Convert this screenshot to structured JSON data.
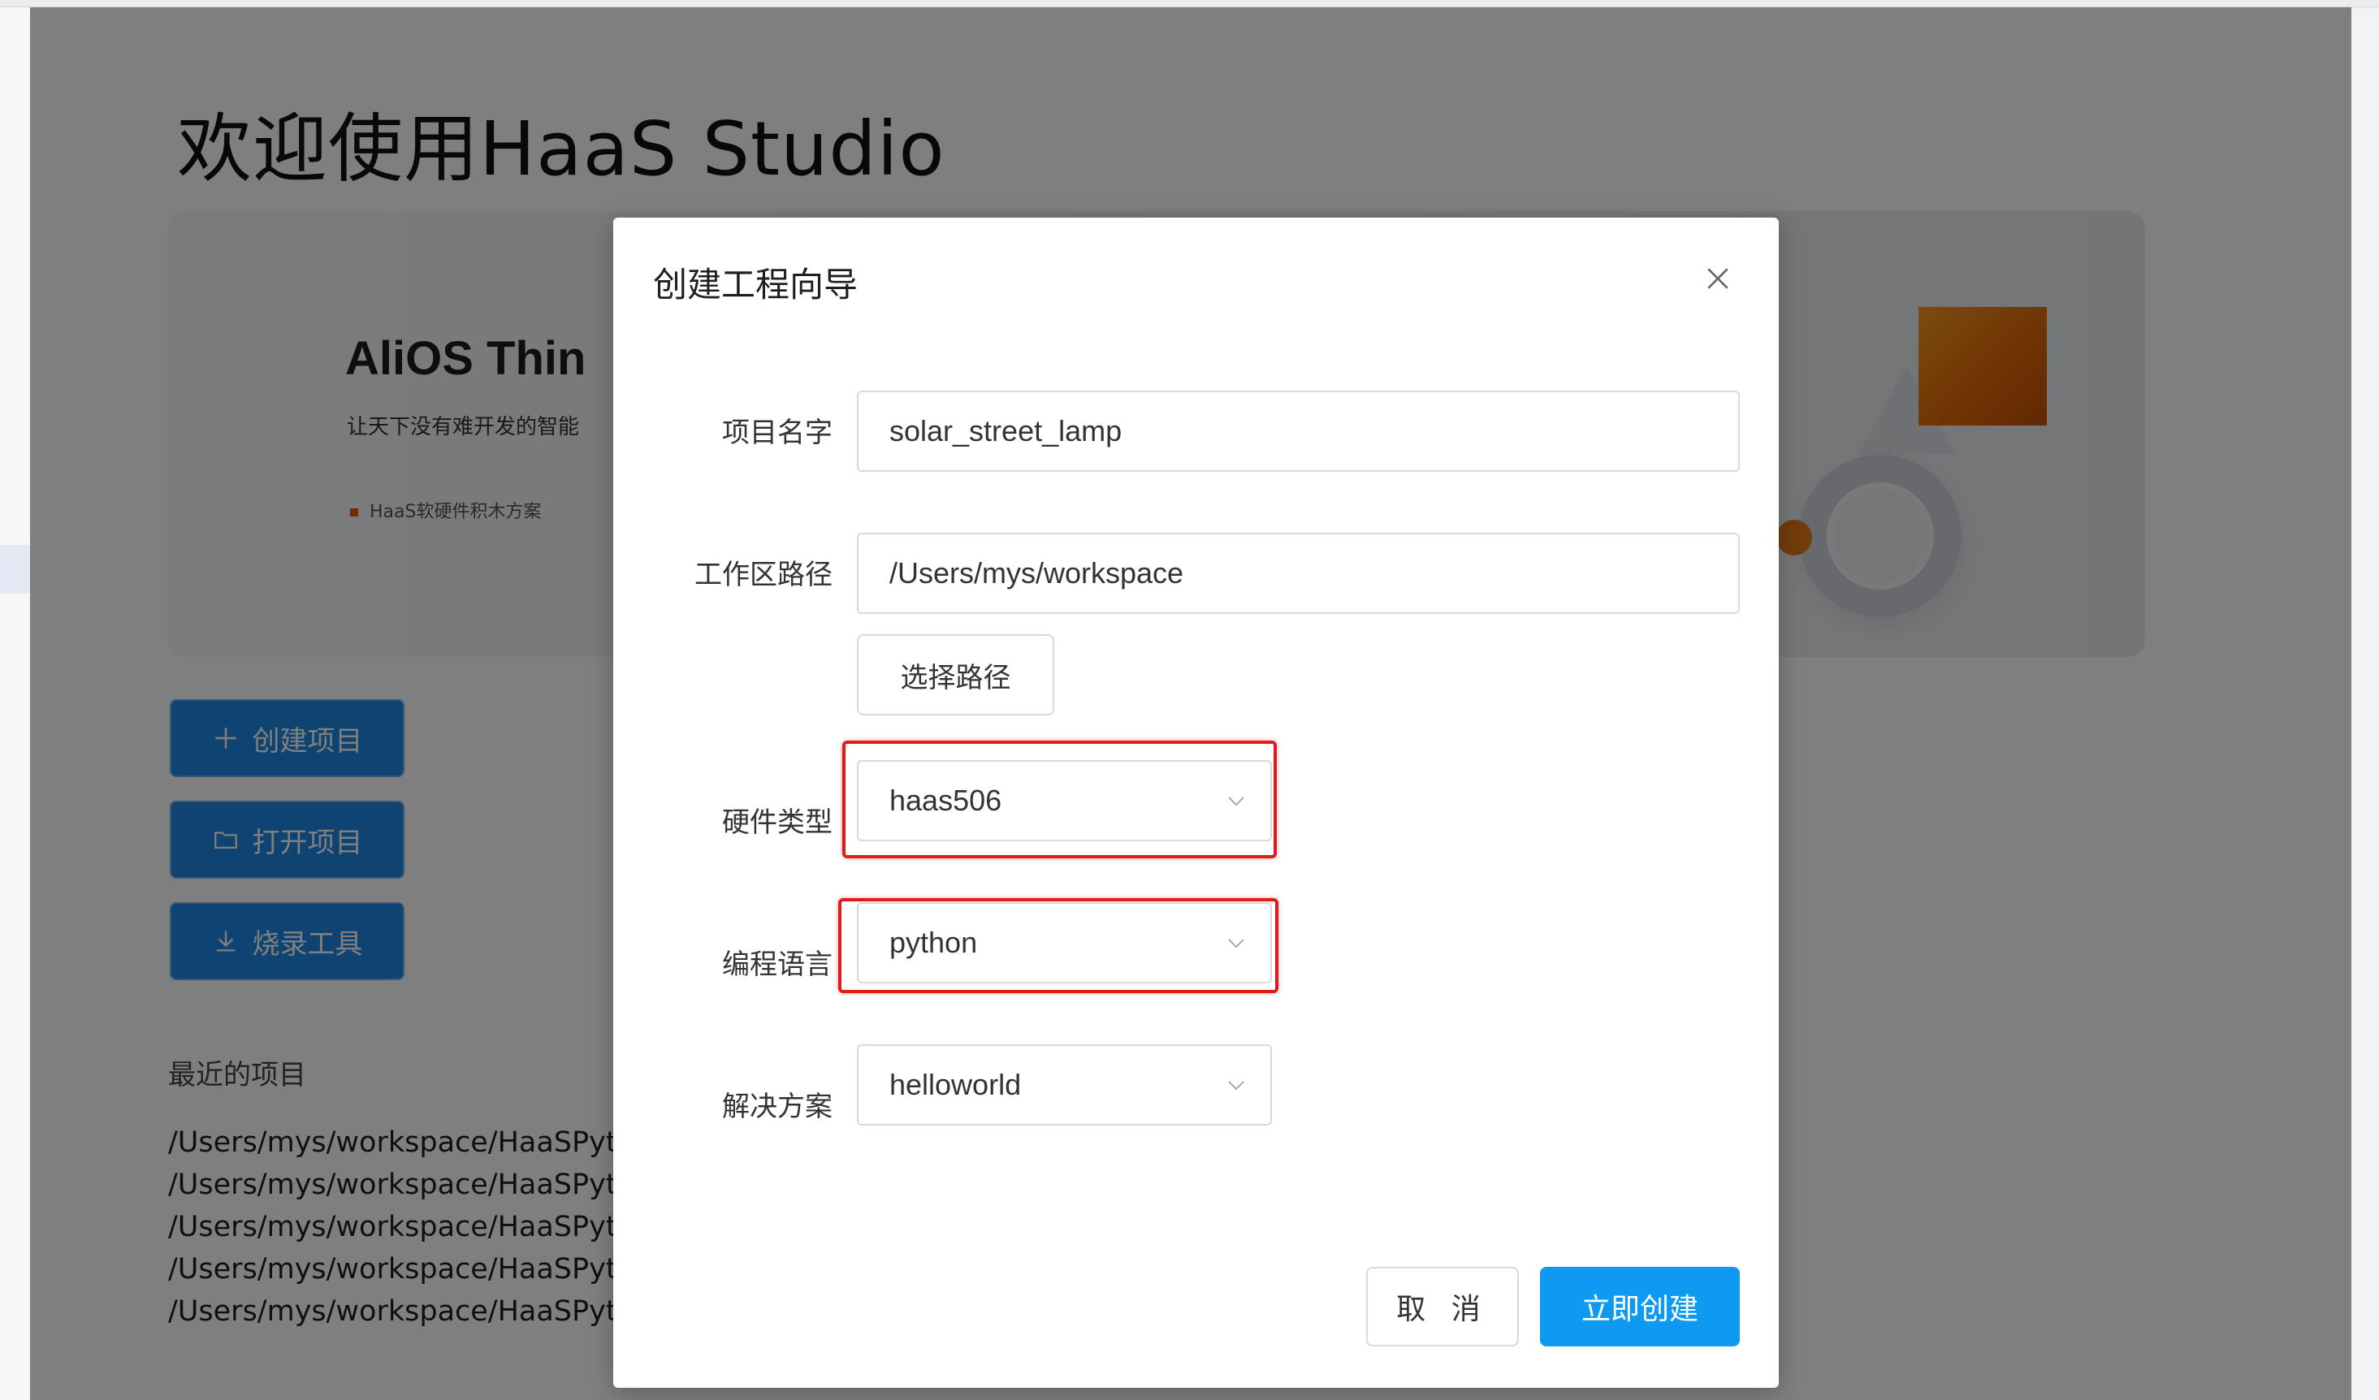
{
  "page": {
    "title": "欢迎使用HaaS Studio",
    "banner": {
      "heading": "AliOS Thin",
      "subtitle": "让天下没有难开发的智能",
      "bullet": "HaaS软硬件积木方案"
    },
    "actions": {
      "create_label": "创建项目",
      "open_label": "打开项目",
      "flash_label": "烧录工具"
    },
    "recent": {
      "title": "最近的项目",
      "items": [
        "/Users/mys/workspace/HaaSPyth",
        "/Users/mys/workspace/HaaSPyth",
        "/Users/mys/workspace/HaaSPyth",
        "/Users/mys/workspace/HaaSPyth",
        "/Users/mys/workspace/HaaSPyth"
      ]
    }
  },
  "modal": {
    "title": "创建工程向导",
    "fields": {
      "project_name": {
        "label": "项目名字",
        "value": "solar_street_lamp"
      },
      "workspace": {
        "label": "工作区路径",
        "value": "/Users/mys/workspace",
        "button": "选择路径"
      },
      "hardware": {
        "label": "硬件类型",
        "value": "haas506"
      },
      "language": {
        "label": "编程语言",
        "value": "python"
      },
      "solution": {
        "label": "解决方案",
        "value": "helloworld"
      }
    },
    "buttons": {
      "cancel": "取 消",
      "create": "立即创建"
    }
  },
  "colors": {
    "primary": "#0e9af0",
    "side_button": "#1e88e5",
    "highlight": "#e01b1b",
    "banner_accent": "#e8540a"
  },
  "icons": [
    "plus-icon",
    "folder-icon",
    "download-icon",
    "close-icon",
    "chevron-down-icon"
  ]
}
